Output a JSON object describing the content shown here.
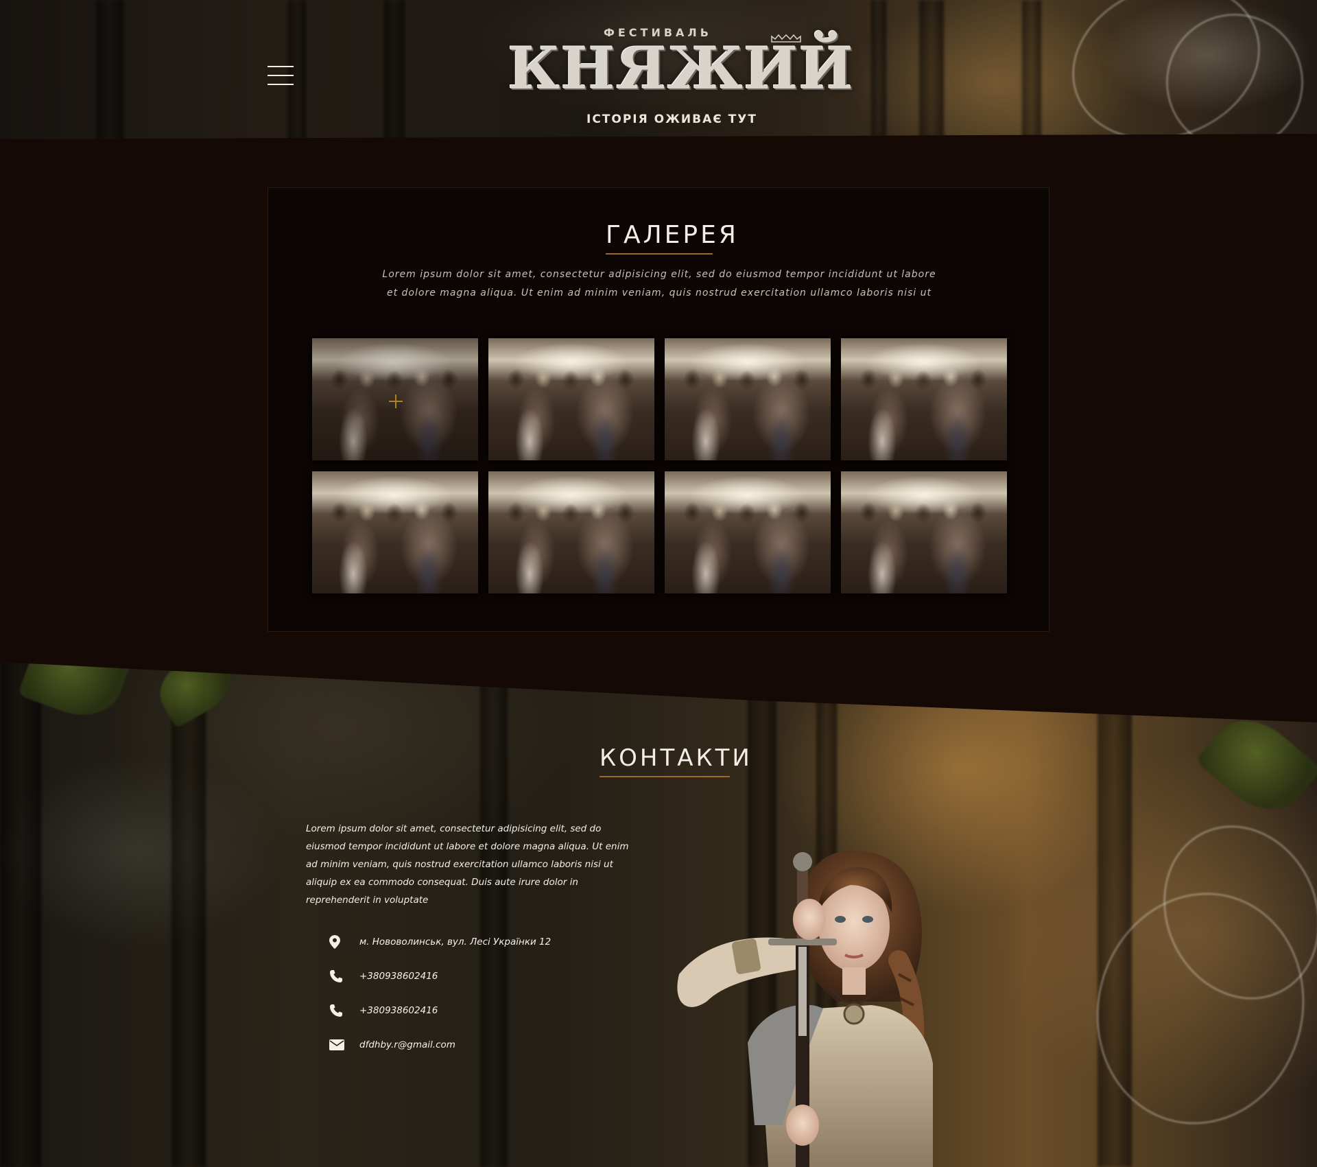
{
  "header": {
    "logo_pre": "ФЕСТИВАЛЬ",
    "logo_main": "КНЯЖИЙ",
    "logo_sub": "ІСТОРІЯ ОЖИВАЄ ТУТ"
  },
  "gallery": {
    "title": "ГАЛЕРЕЯ",
    "description": "Lorem ipsum dolor sit amet, consectetur adipisicing elit, sed do eiusmod tempor incididunt ut labore et dolore magna aliqua. Ut enim ad minim veniam, quis nostrud exercitation ullamco laboris nisi ut",
    "accent_color": "#a06a24",
    "hover_icon": "plus-icon",
    "photo_count": 8
  },
  "contacts": {
    "title": "КОНТАКТИ",
    "description": "Lorem ipsum dolor sit amet, consectetur adipisicing elit, sed do eiusmod tempor incididunt ut labore et dolore magna aliqua. Ut enim ad minim veniam, quis nostrud exercitation ullamco laboris nisi ut aliquip ex ea commodo consequat. Duis aute irure dolor in reprehenderit in voluptate",
    "items": [
      {
        "icon": "location-pin-icon",
        "text": "м. Нововолинськ, вул. Лесі Українки 12"
      },
      {
        "icon": "phone-icon",
        "text": "+380938602416"
      },
      {
        "icon": "phone-icon",
        "text": "+380938602416"
      },
      {
        "icon": "envelope-icon",
        "text": "dfdhby.r@gmail.com"
      }
    ]
  }
}
